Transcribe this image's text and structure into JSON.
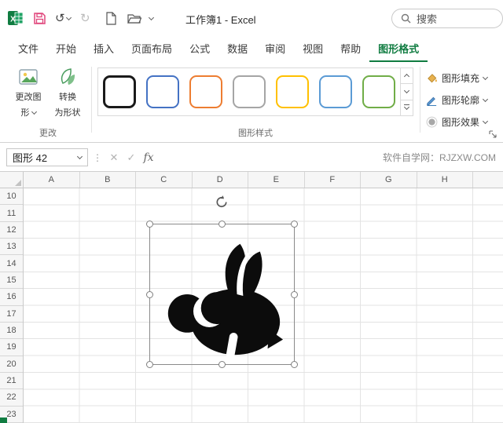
{
  "title_bar": {
    "workbook_title": "工作簿1 - Excel",
    "search_label": "搜索"
  },
  "icons": {
    "undo": "↺",
    "redo": "↻",
    "menu_dots": "⋮"
  },
  "tabs": [
    {
      "label": "文件"
    },
    {
      "label": "开始"
    },
    {
      "label": "插入"
    },
    {
      "label": "页面布局"
    },
    {
      "label": "公式"
    },
    {
      "label": "数据"
    },
    {
      "label": "审阅"
    },
    {
      "label": "视图"
    },
    {
      "label": "帮助"
    },
    {
      "label": "图形格式"
    }
  ],
  "ribbon": {
    "change_group": {
      "label": "更改",
      "change_graphic": {
        "line1": "更改图",
        "line2": "形"
      },
      "convert_shape": {
        "line1": "转换",
        "line2": "为形状"
      }
    },
    "style_group": {
      "label": "图形样式",
      "swatch_colors": [
        "#1a1a1a",
        "#4472c4",
        "#ed7d31",
        "#a5a5a5",
        "#ffc000",
        "#5b9bd5",
        "#70ad47"
      ]
    },
    "format_buttons": [
      {
        "label": "图形填充"
      },
      {
        "label": "图形轮廓"
      },
      {
        "label": "图形效果"
      }
    ]
  },
  "formula_bar": {
    "name_box_value": "图形 42",
    "cancel": "✕",
    "enter": "✓",
    "fx": "fx",
    "watermark": "软件自学网：RJZXW.COM"
  },
  "grid": {
    "column_headers": [
      "A",
      "B",
      "C",
      "D",
      "E",
      "F",
      "G",
      "H",
      ""
    ],
    "row_headers": [
      "10",
      "11",
      "12",
      "13",
      "14",
      "15",
      "16",
      "17",
      "18",
      "19",
      "20",
      "21",
      "22",
      "23"
    ]
  },
  "selection": {
    "object_name": "图形 42"
  },
  "colors": {
    "excel_green": "#107c41",
    "save_icon_pink": "#e0457b",
    "selection_border": "#8a8a8a"
  }
}
